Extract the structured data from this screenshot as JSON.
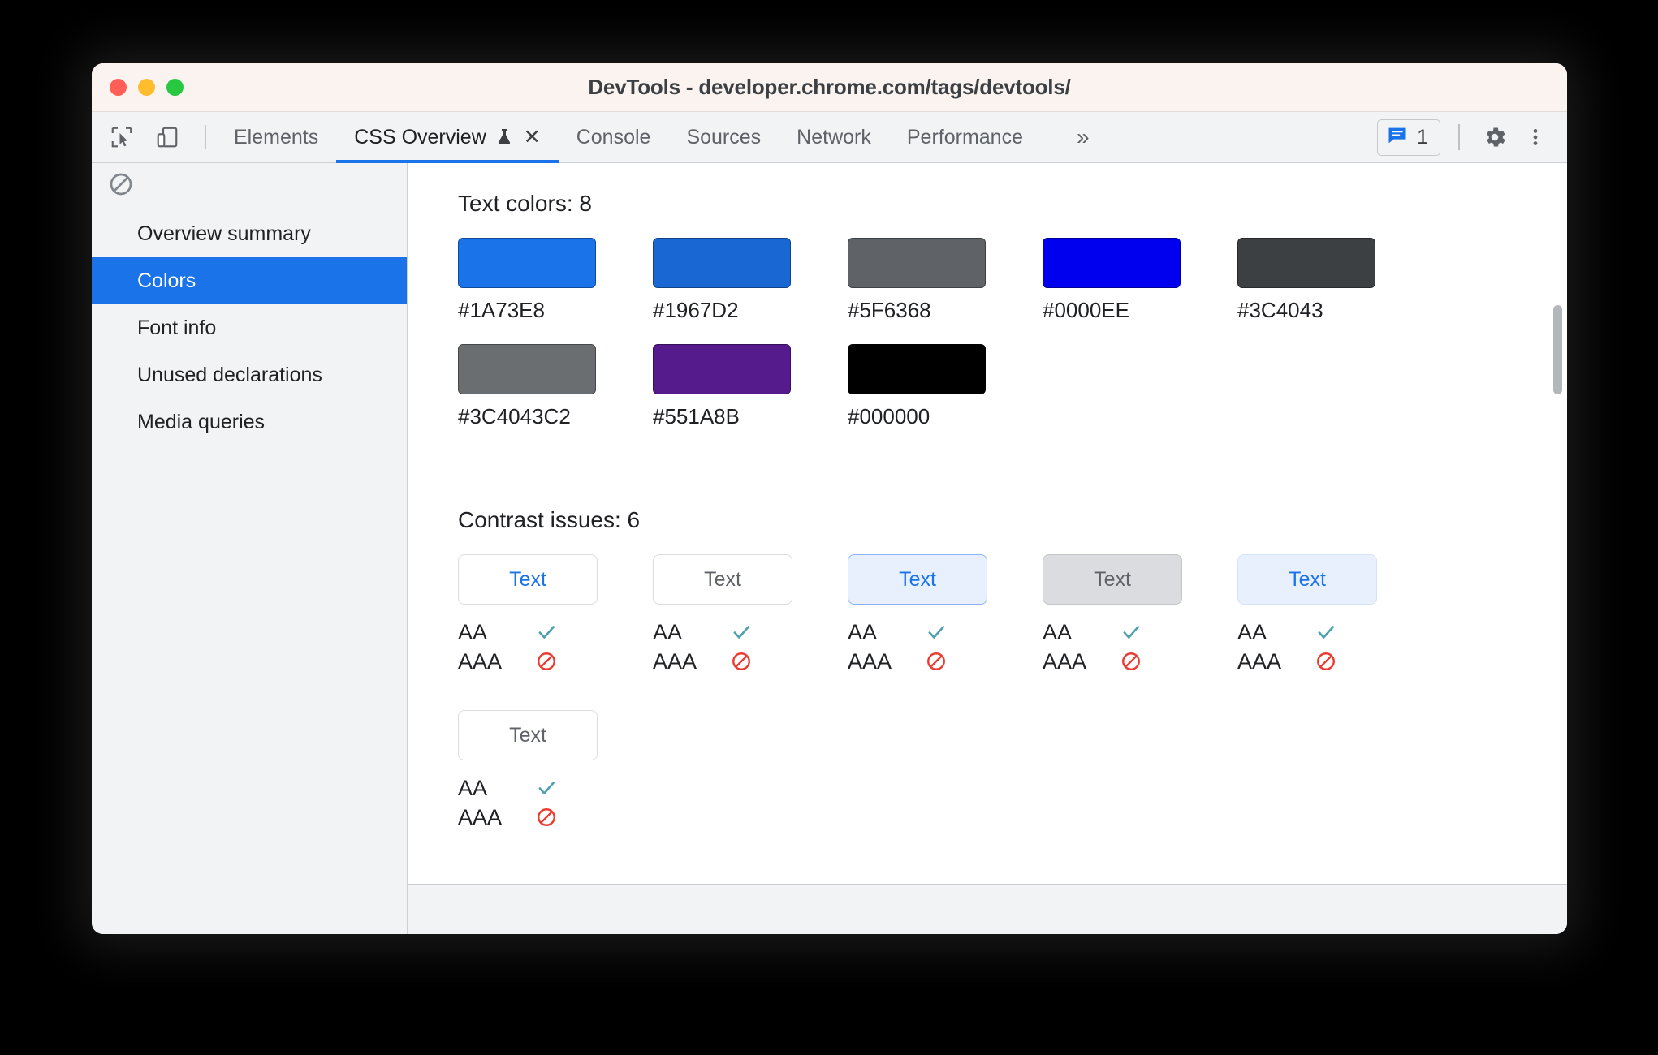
{
  "window": {
    "title": "DevTools - developer.chrome.com/tags/devtools/",
    "traffic_lights": [
      "close",
      "minimize",
      "zoom"
    ]
  },
  "toolbar": {
    "inspect_icon": "inspect-cursor-icon",
    "device_icon": "device-toolbar-icon",
    "tabs": [
      {
        "label": "Elements",
        "active": false
      },
      {
        "label": "CSS Overview",
        "active": true,
        "experimental": true,
        "closable": true
      },
      {
        "label": "Console",
        "active": false
      },
      {
        "label": "Sources",
        "active": false
      },
      {
        "label": "Network",
        "active": false
      },
      {
        "label": "Performance",
        "active": false
      }
    ],
    "more_tabs_label": "»",
    "issues_count": "1",
    "issues_icon": "issues-message-icon",
    "settings_icon": "gear-icon",
    "menu_icon": "kebab-menu-icon",
    "close_tab_label": "✕"
  },
  "sidebar": {
    "clear_icon": "clear-overview-icon",
    "items": [
      {
        "label": "Overview summary",
        "selected": false
      },
      {
        "label": "Colors",
        "selected": true
      },
      {
        "label": "Font info",
        "selected": false
      },
      {
        "label": "Unused declarations",
        "selected": false
      },
      {
        "label": "Media queries",
        "selected": false
      }
    ]
  },
  "main": {
    "text_colors_title": "Text colors: 8",
    "text_colors": [
      {
        "hex": "#1A73E8",
        "css": "#1A73E8"
      },
      {
        "hex": "#1967D2",
        "css": "#1967D2"
      },
      {
        "hex": "#5F6368",
        "css": "#5F6368"
      },
      {
        "hex": "#0000EE",
        "css": "#0000EE"
      },
      {
        "hex": "#3C4043",
        "css": "#3C4043"
      },
      {
        "hex": "#3C4043C2",
        "css": "rgba(60,64,67,0.76)"
      },
      {
        "hex": "#551A8B",
        "css": "#551A8B"
      },
      {
        "hex": "#000000",
        "css": "#000000"
      }
    ],
    "contrast_title": "Contrast issues: 6",
    "contrast_issues": [
      {
        "sample_text": "Text",
        "text_color": "#1A73E8",
        "bg_color": "#FFFFFF",
        "border_color": "#DADCE0",
        "aa_label": "AA",
        "aa_pass": true,
        "aaa_label": "AAA",
        "aaa_pass": false
      },
      {
        "sample_text": "Text",
        "text_color": "#5F6368",
        "bg_color": "#FFFFFF",
        "border_color": "#DADCE0",
        "aa_label": "AA",
        "aa_pass": true,
        "aaa_label": "AAA",
        "aaa_pass": false
      },
      {
        "sample_text": "Text",
        "text_color": "#1A73E8",
        "bg_color": "#E8F0FE",
        "border_color": "#8AB4F8",
        "aa_label": "AA",
        "aa_pass": true,
        "aaa_label": "AAA",
        "aaa_pass": false
      },
      {
        "sample_text": "Text",
        "text_color": "#5F6368",
        "bg_color": "#DADCE0",
        "border_color": "#C4C7C9",
        "aa_label": "AA",
        "aa_pass": true,
        "aaa_label": "AAA",
        "aaa_pass": false
      },
      {
        "sample_text": "Text",
        "text_color": "#1A73E8",
        "bg_color": "#E8F0FE",
        "border_color": "#D6E2F7",
        "aa_label": "AA",
        "aa_pass": true,
        "aaa_label": "AAA",
        "aaa_pass": false
      },
      {
        "sample_text": "Text",
        "text_color": "#5F6368",
        "bg_color": "#FFFFFF",
        "border_color": "#DADCE0",
        "aa_label": "AA",
        "aa_pass": true,
        "aaa_label": "AAA",
        "aaa_pass": false
      }
    ],
    "pass_icon": "checkmark-icon",
    "fail_icon": "blocked-icon"
  },
  "colors": {
    "accent": "#1A73E8",
    "pass_check": "#4EA0AE",
    "fail_block": "#EB3B30"
  }
}
